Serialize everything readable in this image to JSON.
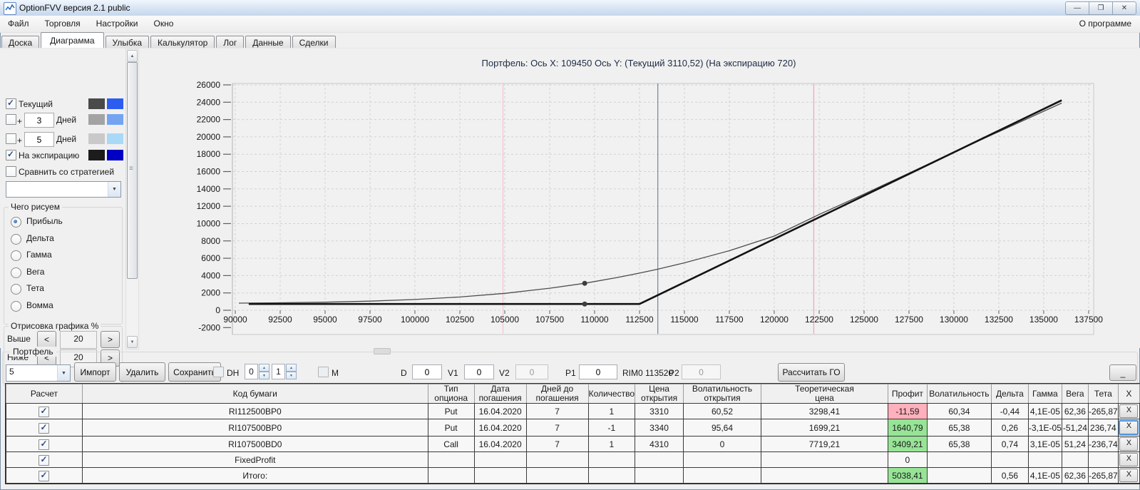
{
  "window": {
    "title": "OptionFVV версия 2.1 public",
    "controls": [
      {
        "name": "minimize",
        "glyph": "—"
      },
      {
        "name": "maximize",
        "glyph": "❐"
      },
      {
        "name": "close",
        "glyph": "✕"
      }
    ]
  },
  "menubar": {
    "items": [
      "Файл",
      "Торговля",
      "Настройки",
      "Окно"
    ],
    "right_item": "О программе"
  },
  "tabs": {
    "items": [
      "Доска",
      "Диаграмма",
      "Улыбка",
      "Калькулятор",
      "Лог",
      "Данные",
      "Сделки"
    ],
    "active": "Диаграмма"
  },
  "sidebar": {
    "series_toggles": [
      {
        "label": "Текущий",
        "checked": true,
        "has_input": false,
        "swatches": [
          "#4a4a4a",
          "#2d5cf0"
        ]
      },
      {
        "label": "Дней",
        "prefix": "+",
        "checked": false,
        "has_input": true,
        "input_value": "3",
        "swatches": [
          "#a3a3a3",
          "#74a3f2"
        ]
      },
      {
        "label": "Дней",
        "prefix": "+",
        "checked": false,
        "has_input": true,
        "input_value": "5",
        "swatches": [
          "#c9c9c9",
          "#a9d9f7"
        ]
      },
      {
        "label": "На экспирацию",
        "checked": true,
        "has_input": false,
        "swatches": [
          "#1c1c1c",
          "#0000c4"
        ]
      }
    ],
    "compare_checkbox_label": "Сравнить со стратегией",
    "strategy_dropdown_value": "",
    "draw_group": {
      "title": "Чего рисуем",
      "options": [
        "Прибыль",
        "Дельта",
        "Гамма",
        "Вега",
        "Тета",
        "Вомма"
      ],
      "selected": "Прибыль"
    },
    "range_group": {
      "title": "Отрисовка графика %",
      "rows": [
        {
          "label": "Выше",
          "value": "20",
          "dec": "<",
          "inc": ">"
        },
        {
          "label": "Ниже",
          "value": "20",
          "dec": "<",
          "inc": ">"
        }
      ]
    }
  },
  "chart_data": {
    "type": "line",
    "title": "Портфель:  Ось X: 109450  Ось Y:   (Текущий 3110,52)   (На экспирацию 720)",
    "xlabel": "",
    "ylabel": "",
    "xlim": [
      90000,
      137500
    ],
    "ylim": [
      -2000,
      26000
    ],
    "grid": true,
    "x_ticks": [
      90000,
      92500,
      95000,
      97500,
      100000,
      102500,
      105000,
      107500,
      110000,
      112500,
      115000,
      117500,
      120000,
      122500,
      125000,
      127500,
      130000,
      132500,
      135000,
      137500
    ],
    "y_ticks": [
      -2000,
      0,
      2000,
      4000,
      6000,
      8000,
      10000,
      12000,
      14000,
      16000,
      18000,
      20000,
      22000,
      24000,
      26000
    ],
    "series": [
      {
        "name": "Текущий",
        "color": "#4d4d4d",
        "width": 1.3,
        "points": [
          [
            90200,
            820
          ],
          [
            92500,
            860
          ],
          [
            95000,
            930
          ],
          [
            97500,
            1050
          ],
          [
            100000,
            1240
          ],
          [
            102500,
            1530
          ],
          [
            105000,
            1950
          ],
          [
            107500,
            2540
          ],
          [
            109450,
            3110
          ],
          [
            111250,
            3780
          ],
          [
            112500,
            4290
          ],
          [
            113520,
            4740
          ],
          [
            115000,
            5470
          ],
          [
            117500,
            6870
          ],
          [
            120000,
            8560
          ],
          [
            122500,
            11050
          ],
          [
            125000,
            13400
          ],
          [
            127500,
            15820
          ],
          [
            130000,
            18230
          ],
          [
            132500,
            20600
          ],
          [
            134300,
            22300
          ],
          [
            136000,
            23900
          ]
        ]
      },
      {
        "name": "На экспирацию",
        "color": "#131313",
        "width": 2.6,
        "points": [
          [
            90750,
            720
          ],
          [
            112500,
            720
          ],
          [
            136000,
            24220
          ]
        ]
      }
    ],
    "markers": [
      {
        "x": 109450,
        "y": 3110.52
      },
      {
        "x": 109450,
        "y": 720
      }
    ],
    "vlines": [
      {
        "x": 104900,
        "color": "#f6c3ce"
      },
      {
        "x": 113520,
        "color": "#76829b"
      },
      {
        "x": 122200,
        "color": "#f8a2b4"
      }
    ]
  },
  "portfolio": {
    "group_label": "Портфель",
    "selector_value": "5",
    "import_button": "Импорт",
    "delete_button": "Удалить",
    "save_button": "Сохранить",
    "dh_label": "DH",
    "dh_spin1": "0",
    "dh_spin2": "1",
    "m_label": "M",
    "fields": [
      {
        "label": "D",
        "value": "0",
        "disabled": false
      },
      {
        "label": "V1",
        "value": "0",
        "disabled": false
      },
      {
        "label": "V2",
        "value": "0",
        "disabled": true
      },
      {
        "label": "P1",
        "value": "0",
        "disabled": false
      },
      {
        "label": "P2",
        "value": "0",
        "disabled": true
      }
    ],
    "rim_label": "RIM0 113520",
    "calc_button": "Рассчитать ГО",
    "collapse_button": "_"
  },
  "table": {
    "columns": [
      "Расчет",
      "Код бумаги",
      "Тип\nопциона",
      "Дата\nпогашения",
      "Дней до\nпогашения",
      "Количество",
      "Цена\nоткрытия",
      "Волатильность\nоткрытия",
      "Теоретическая\nцена",
      "Профит",
      "Волатильность",
      "Дельта",
      "Гамма",
      "Вега",
      "Тета",
      "X"
    ],
    "rows": [
      {
        "checked": true,
        "code": "RI112500BP0",
        "type": "Put",
        "date": "16.04.2020",
        "days": "7",
        "qty": "1",
        "open_price": "3310",
        "open_vol": "60,52",
        "theo": "3298,41",
        "profit": "-11,59",
        "profit_color": "pink",
        "vol": "60,34",
        "delta": "-0,44",
        "gamma": "4,1E-05",
        "vega": "62,36",
        "theta": "-265,87",
        "x": "X",
        "x_focused": false
      },
      {
        "checked": true,
        "code": "RI107500BP0",
        "type": "Put",
        "date": "16.04.2020",
        "days": "7",
        "qty": "-1",
        "open_price": "3340",
        "open_vol": "95,64",
        "theo": "1699,21",
        "profit": "1640,79",
        "profit_color": "green",
        "vol": "65,38",
        "delta": "0,26",
        "gamma": "-3,1E-05",
        "vega": "-51,24",
        "theta": "236,74",
        "x": "X",
        "x_focused": true
      },
      {
        "checked": true,
        "code": "RI107500BD0",
        "type": "Call",
        "date": "16.04.2020",
        "days": "7",
        "qty": "1",
        "open_price": "4310",
        "open_vol": "0",
        "theo": "7719,21",
        "profit": "3409,21",
        "profit_color": "green",
        "vol": "65,38",
        "delta": "0,74",
        "gamma": "3,1E-05",
        "vega": "51,24",
        "theta": "-236,74",
        "x": "X",
        "x_focused": false
      },
      {
        "checked": true,
        "code": "FixedProfit",
        "type": "",
        "date": "",
        "days": "",
        "qty": "",
        "open_price": "",
        "open_vol": "",
        "theo": "",
        "profit": "0",
        "profit_color": "",
        "vol": "",
        "delta": "",
        "gamma": "",
        "vega": "",
        "theta": "",
        "x": "X",
        "x_focused": false
      },
      {
        "checked": true,
        "code": "Итого:",
        "type": "",
        "date": "",
        "days": "",
        "qty": "",
        "open_price": "",
        "open_vol": "",
        "theo": "",
        "profit": "5038,41",
        "profit_color": "green",
        "vol": "",
        "delta": "0,56",
        "gamma": "4,1E-05",
        "vega": "62,36",
        "theta": "-265,87",
        "x": "X",
        "x_focused": false
      }
    ]
  }
}
